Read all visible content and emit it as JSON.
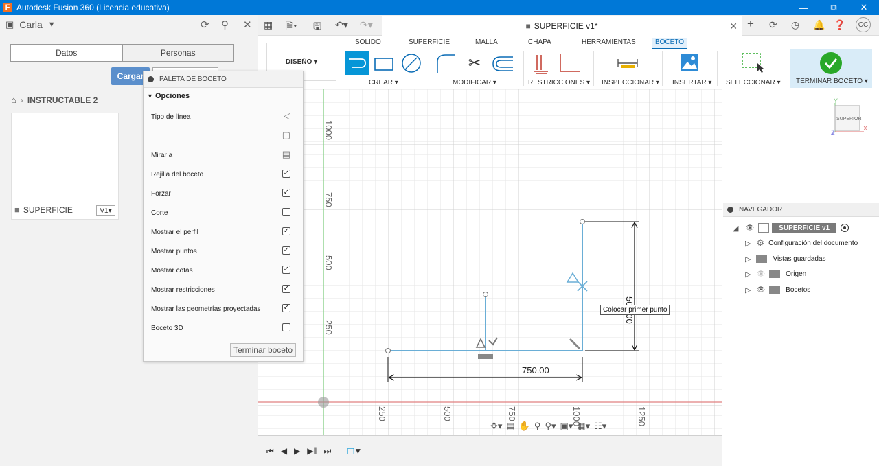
{
  "window": {
    "title": "Autodesk Fusion 360 (Licencia educativa)",
    "logo": "F"
  },
  "user": {
    "name": "Carla",
    "initials": "CC"
  },
  "panel_tabs": [
    "Datos",
    "Personas"
  ],
  "upload_label": "Cargar",
  "breadcrumb": {
    "project": "INSTRUCTABLE 2"
  },
  "file": {
    "name": "SUPERFICIE",
    "version": "V1▾"
  },
  "document_tab": {
    "title": "SUPERFICIE v1*"
  },
  "workspace": {
    "label": "DISEÑO ▾"
  },
  "ribbon_tabs": [
    "SOLIDO",
    "SUPERFICIE",
    "MALLA",
    "CHAPA",
    "HERRAMIENTAS",
    "BOCETO"
  ],
  "ribbon_groups": [
    "CREAR ▾",
    "MODIFICAR ▾",
    "RESTRICCIONES ▾",
    "INSPECCIONAR ▾",
    "INSERTAR ▾",
    "SELECCIONAR ▾",
    "TERMINAR BOCETO ▾"
  ],
  "palette": {
    "title": "PALETA DE BOCETO",
    "section": "Opciones",
    "rows": [
      {
        "label": "Tipo de línea",
        "type": "icon"
      },
      {
        "label": "",
        "type": "icon"
      },
      {
        "label": "Mirar a",
        "type": "icon"
      },
      {
        "label": "Rejilla del boceto",
        "type": "check",
        "checked": true
      },
      {
        "label": "Forzar",
        "type": "check",
        "checked": true
      },
      {
        "label": "Corte",
        "type": "check",
        "checked": false
      },
      {
        "label": "Mostrar el perfil",
        "type": "check",
        "checked": true
      },
      {
        "label": "Mostrar puntos",
        "type": "check",
        "checked": true
      },
      {
        "label": "Mostrar cotas",
        "type": "check",
        "checked": true
      },
      {
        "label": "Mostrar restricciones",
        "type": "check",
        "checked": true
      },
      {
        "label": "Mostrar las geometrías proyectadas",
        "type": "check",
        "checked": true
      },
      {
        "label": "Boceto 3D",
        "type": "check",
        "checked": false
      }
    ],
    "finish_button": "Terminar boceto"
  },
  "canvas": {
    "tooltip": "Colocar primer punto",
    "dimension_horizontal": "750.00",
    "dimension_vertical": "500.00",
    "y_axis_labels": [
      "1000",
      "750",
      "500",
      "250"
    ],
    "x_axis_labels": [
      "250",
      "500",
      "750",
      "1000",
      "1250"
    ]
  },
  "viewcube": {
    "face": "SUPERIOR",
    "x": "X",
    "y": "Y",
    "z": "Z"
  },
  "navigator": {
    "title": "NAVEGADOR",
    "root": "SUPERFICIE v1",
    "items": [
      "Configuración del documento",
      "Vistas guardadas",
      "Origen",
      "Bocetos"
    ]
  },
  "colors": {
    "accent": "#0696d7",
    "sketch": "#6aaed6",
    "titlebar": "#0078d7",
    "finish": "#29a829"
  }
}
